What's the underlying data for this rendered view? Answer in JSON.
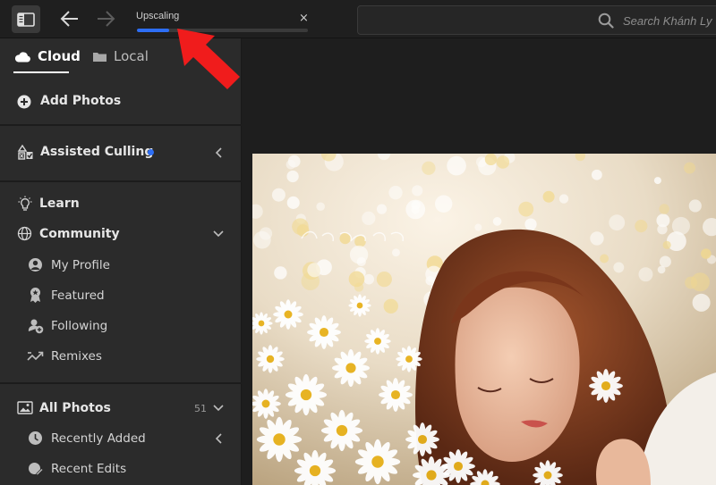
{
  "topbar": {
    "progress": {
      "label": "Upscaling",
      "fraction": 0.19,
      "close_glyph": "×"
    },
    "search": {
      "placeholder": "Search Khánh Ly"
    },
    "icons": [
      "panel-toggle-icon",
      "back-arrow-icon",
      "forward-arrow-icon",
      "search-icon"
    ]
  },
  "sidebar": {
    "tabs": [
      {
        "label": "Cloud",
        "icon": "cloud-icon",
        "active": true
      },
      {
        "label": "Local",
        "icon": "folder-icon",
        "active": false
      }
    ],
    "add_photos": {
      "label": "Add Photos",
      "icon": "plus-circle-icon"
    },
    "assisted_culling": {
      "label": "Assisted Culling",
      "icon": "culling-icon",
      "dot_color": "#2d6ef5"
    },
    "learn": {
      "label": "Learn",
      "icon": "lightbulb-icon"
    },
    "community": {
      "label": "Community",
      "icon": "globe-icon",
      "items": [
        {
          "label": "My Profile",
          "icon": "profile-icon"
        },
        {
          "label": "Featured",
          "icon": "award-icon"
        },
        {
          "label": "Following",
          "icon": "following-icon"
        },
        {
          "label": "Remixes",
          "icon": "remix-icon"
        }
      ]
    },
    "all_photos": {
      "label": "All Photos",
      "icon": "photos-icon",
      "count": "51",
      "items": [
        {
          "label": "Recently Added",
          "icon": "clock-icon"
        },
        {
          "label": "Recent Edits",
          "icon": "recent-edits-icon"
        }
      ]
    }
  },
  "colors": {
    "accent_blue": "#2d6ef5",
    "annotation_red": "#f01c1c",
    "sidebar_bg": "#2b2b2b",
    "app_bg": "#1e1e1e"
  }
}
